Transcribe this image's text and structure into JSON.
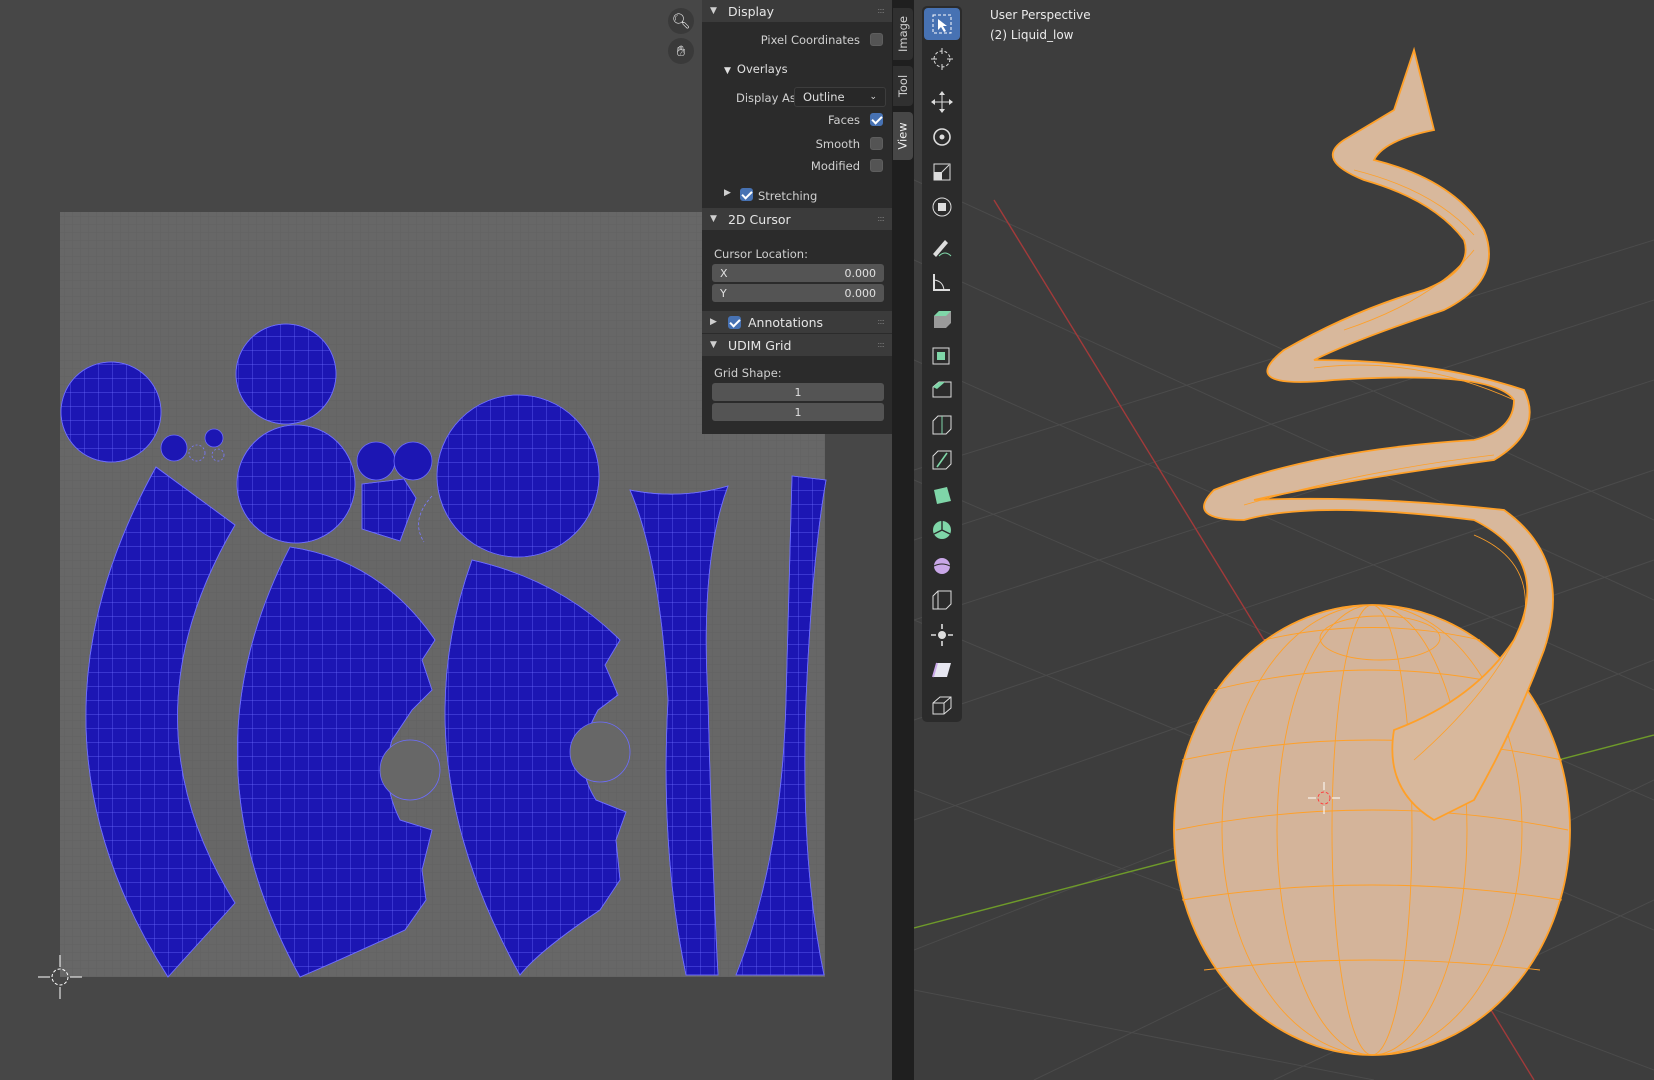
{
  "uv_editor": {
    "nav_buttons": {
      "zoom_icon": "zoom-icon",
      "pan_icon": "hand-pan-icon"
    }
  },
  "sidebar": {
    "display": {
      "title": "Display",
      "pixel_coordinates_label": "Pixel Coordinates",
      "pixel_coordinates_checked": false,
      "overlays": {
        "title": "Overlays",
        "display_as_label": "Display As",
        "display_as_value": "Outline",
        "faces_label": "Faces",
        "faces_checked": true,
        "smooth_label": "Smooth",
        "smooth_checked": false,
        "modified_label": "Modified",
        "modified_checked": false,
        "stretching_label": "Stretching",
        "stretching_checked": true
      }
    },
    "cursor_2d": {
      "title": "2D Cursor",
      "location_label": "Cursor Location:",
      "x_label": "X",
      "x_value": "0.000",
      "y_label": "Y",
      "y_value": "0.000"
    },
    "annotations": {
      "title": "Annotations",
      "checked": true
    },
    "udim_grid": {
      "title": "UDIM Grid",
      "shape_label": "Grid Shape:",
      "shape_x": "1",
      "shape_y": "1"
    },
    "tabs": [
      "Image",
      "Tool",
      "View"
    ],
    "active_tab": "View"
  },
  "viewport": {
    "perspective_label": "User Perspective",
    "object_label": "(2) Liquid_low",
    "tools": [
      "select-box-icon",
      "cursor-icon",
      "move-icon",
      "rotate-icon",
      "scale-icon",
      "transform-icon",
      "annotate-icon",
      "measure-icon",
      "extrude-region-icon",
      "inset-faces-icon",
      "bevel-icon",
      "loop-cut-icon",
      "knife-icon",
      "poly-build-icon",
      "spin-icon",
      "smooth-vertices-icon",
      "edge-slide-icon",
      "shrink-fatten-icon",
      "shear-icon",
      "rip-region-icon"
    ],
    "active_tool": "select-box-icon"
  },
  "colors": {
    "uv_island": "#1a14b8",
    "uv_edge": "#5c5cff",
    "mesh_fill": "#d4b49a",
    "mesh_wire": "#ffa028",
    "x_axis": "#a23a3a",
    "y_axis": "#6e9a2a",
    "accent": "#4772b3"
  }
}
